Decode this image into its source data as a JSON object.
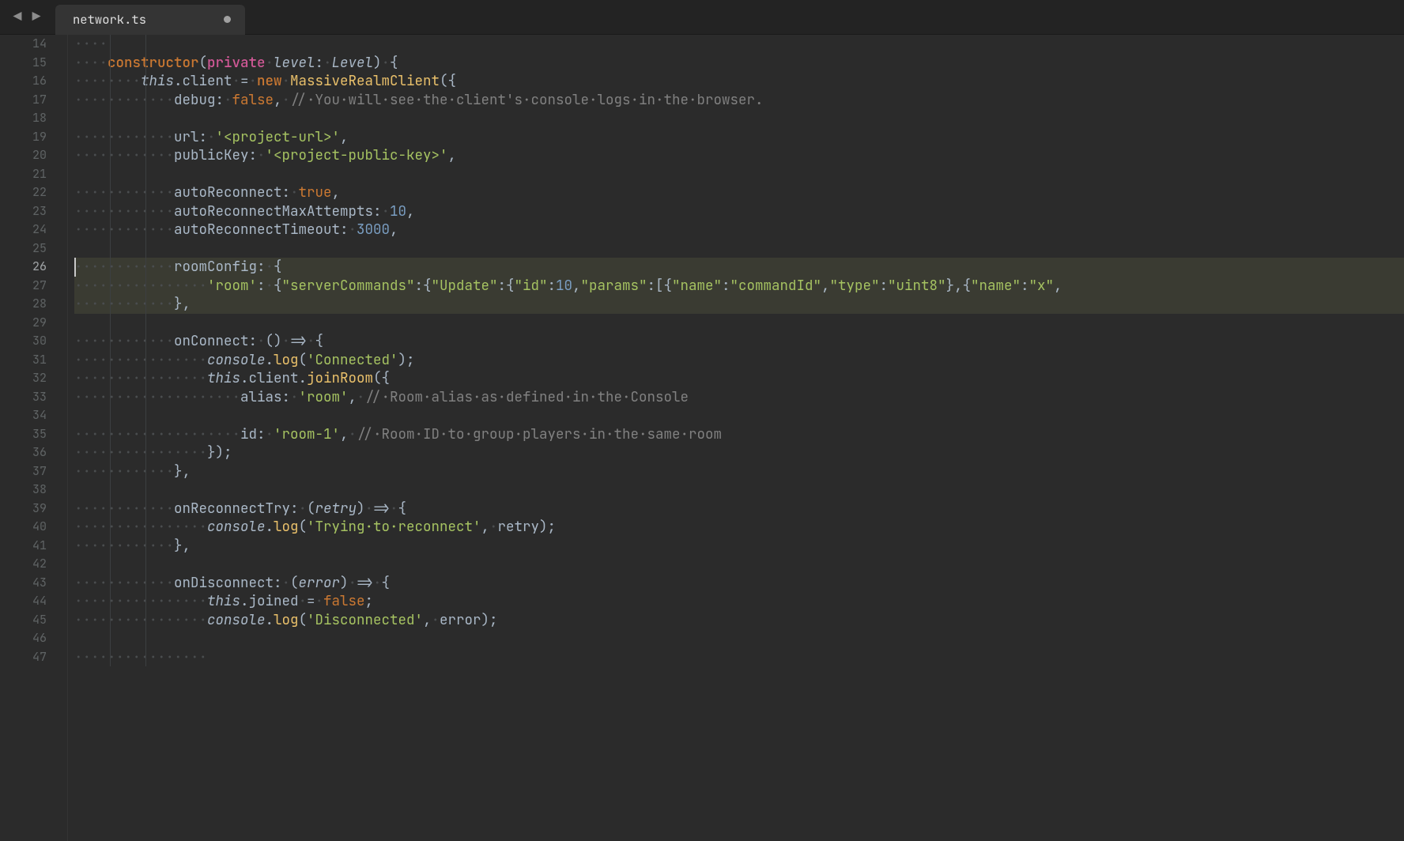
{
  "tab": {
    "filename": "network.ts",
    "modified": true
  },
  "editor": {
    "first_line": 14,
    "cursor_line": 26,
    "selected_lines": [
      26,
      27,
      28
    ],
    "lines": [
      {
        "n": 14,
        "indent": 1,
        "tokens": []
      },
      {
        "n": 15,
        "indent": 1,
        "tokens": [
          [
            "kw",
            "constructor"
          ],
          [
            "op",
            "("
          ],
          [
            "kw2",
            "private"
          ],
          [
            "ws",
            "·"
          ],
          [
            "param",
            "level"
          ],
          [
            "op",
            ":"
          ],
          [
            "ws",
            "·"
          ],
          [
            "type",
            "Level"
          ],
          [
            "op",
            ")"
          ],
          [
            "ws",
            "·"
          ],
          [
            "op",
            "{"
          ]
        ]
      },
      {
        "n": 16,
        "indent": 2,
        "tokens": [
          [
            "this",
            "this"
          ],
          [
            "dot",
            "."
          ],
          [
            "prop",
            "client"
          ],
          [
            "ws",
            "·"
          ],
          [
            "op",
            "="
          ],
          [
            "ws",
            "·"
          ],
          [
            "kw",
            "new"
          ],
          [
            "ws",
            "·"
          ],
          [
            "fn",
            "MassiveRealmClient"
          ],
          [
            "op",
            "({"
          ]
        ]
      },
      {
        "n": 17,
        "indent": 3,
        "tokens": [
          [
            "prop",
            "debug"
          ],
          [
            "op",
            ":"
          ],
          [
            "ws",
            "·"
          ],
          [
            "bool",
            "false"
          ],
          [
            "op",
            ","
          ],
          [
            "ws",
            "·"
          ],
          [
            "comment",
            "//·You·will·see·the·client's·console·logs·in·the·browser."
          ]
        ]
      },
      {
        "n": 18,
        "indent": 0,
        "tokens": []
      },
      {
        "n": 19,
        "indent": 3,
        "tokens": [
          [
            "prop",
            "url"
          ],
          [
            "op",
            ":"
          ],
          [
            "ws",
            "·"
          ],
          [
            "str",
            "'<project-url>'"
          ],
          [
            "op",
            ","
          ]
        ]
      },
      {
        "n": 20,
        "indent": 3,
        "tokens": [
          [
            "prop",
            "publicKey"
          ],
          [
            "op",
            ":"
          ],
          [
            "ws",
            "·"
          ],
          [
            "str",
            "'<project-public-key>'"
          ],
          [
            "op",
            ","
          ]
        ]
      },
      {
        "n": 21,
        "indent": 0,
        "tokens": []
      },
      {
        "n": 22,
        "indent": 3,
        "tokens": [
          [
            "prop",
            "autoReconnect"
          ],
          [
            "op",
            ":"
          ],
          [
            "ws",
            "·"
          ],
          [
            "bool",
            "true"
          ],
          [
            "op",
            ","
          ]
        ]
      },
      {
        "n": 23,
        "indent": 3,
        "tokens": [
          [
            "prop",
            "autoReconnectMaxAttempts"
          ],
          [
            "op",
            ":"
          ],
          [
            "ws",
            "·"
          ],
          [
            "num",
            "10"
          ],
          [
            "op",
            ","
          ]
        ]
      },
      {
        "n": 24,
        "indent": 3,
        "tokens": [
          [
            "prop",
            "autoReconnectTimeout"
          ],
          [
            "op",
            ":"
          ],
          [
            "ws",
            "·"
          ],
          [
            "num",
            "3000"
          ],
          [
            "op",
            ","
          ]
        ]
      },
      {
        "n": 25,
        "indent": 0,
        "tokens": []
      },
      {
        "n": 26,
        "indent": 3,
        "tokens": [
          [
            "prop",
            "roomConfig"
          ],
          [
            "op",
            ":"
          ],
          [
            "ws",
            "·"
          ],
          [
            "op",
            "{"
          ]
        ]
      },
      {
        "n": 27,
        "indent": 4,
        "tokens": [
          [
            "str",
            "'room'"
          ],
          [
            "op",
            ":"
          ],
          [
            "ws",
            "·"
          ],
          [
            "op",
            "{"
          ],
          [
            "key",
            "\"serverCommands\""
          ],
          [
            "op",
            ":{"
          ],
          [
            "key",
            "\"Update\""
          ],
          [
            "op",
            ":{"
          ],
          [
            "key",
            "\"id\""
          ],
          [
            "op",
            ":"
          ],
          [
            "num",
            "10"
          ],
          [
            "op",
            ","
          ],
          [
            "key",
            "\"params\""
          ],
          [
            "op",
            ":[{"
          ],
          [
            "key",
            "\"name\""
          ],
          [
            "op",
            ":"
          ],
          [
            "key",
            "\"commandId\""
          ],
          [
            "op",
            ","
          ],
          [
            "key",
            "\"type\""
          ],
          [
            "op",
            ":"
          ],
          [
            "key",
            "\"uint8\""
          ],
          [
            "op",
            "},{"
          ],
          [
            "key",
            "\"name\""
          ],
          [
            "op",
            ":"
          ],
          [
            "key",
            "\"x\""
          ],
          [
            "op",
            ","
          ]
        ]
      },
      {
        "n": 28,
        "indent": 3,
        "tokens": [
          [
            "op",
            "},"
          ]
        ]
      },
      {
        "n": 29,
        "indent": 0,
        "tokens": []
      },
      {
        "n": 30,
        "indent": 3,
        "tokens": [
          [
            "prop",
            "onConnect"
          ],
          [
            "op",
            ":"
          ],
          [
            "ws",
            "·"
          ],
          [
            "op",
            "()"
          ],
          [
            "ws",
            "·"
          ],
          [
            "op",
            "=>"
          ],
          [
            "ws",
            "·"
          ],
          [
            "op",
            "{"
          ]
        ]
      },
      {
        "n": 31,
        "indent": 4,
        "tokens": [
          [
            "param",
            "console"
          ],
          [
            "dot",
            "."
          ],
          [
            "call",
            "log"
          ],
          [
            "op",
            "("
          ],
          [
            "str",
            "'Connected'"
          ],
          [
            "op",
            ");"
          ]
        ]
      },
      {
        "n": 32,
        "indent": 4,
        "tokens": [
          [
            "this",
            "this"
          ],
          [
            "dot",
            "."
          ],
          [
            "prop",
            "client"
          ],
          [
            "dot",
            "."
          ],
          [
            "call",
            "joinRoom"
          ],
          [
            "op",
            "({"
          ]
        ]
      },
      {
        "n": 33,
        "indent": 5,
        "tokens": [
          [
            "prop",
            "alias"
          ],
          [
            "op",
            ":"
          ],
          [
            "ws",
            "·"
          ],
          [
            "str",
            "'room'"
          ],
          [
            "op",
            ","
          ],
          [
            "ws",
            "·"
          ],
          [
            "comment",
            "//·Room·alias·as·defined·in·the·Console"
          ]
        ]
      },
      {
        "n": 34,
        "indent": 0,
        "tokens": []
      },
      {
        "n": 35,
        "indent": 5,
        "tokens": [
          [
            "prop",
            "id"
          ],
          [
            "op",
            ":"
          ],
          [
            "ws",
            "·"
          ],
          [
            "str",
            "'room-1'"
          ],
          [
            "op",
            ","
          ],
          [
            "ws",
            "·"
          ],
          [
            "comment",
            "//·Room·ID·to·group·players·in·the·same·room"
          ]
        ]
      },
      {
        "n": 36,
        "indent": 4,
        "tokens": [
          [
            "op",
            "});"
          ]
        ]
      },
      {
        "n": 37,
        "indent": 3,
        "tokens": [
          [
            "op",
            "},"
          ]
        ]
      },
      {
        "n": 38,
        "indent": 0,
        "tokens": []
      },
      {
        "n": 39,
        "indent": 3,
        "tokens": [
          [
            "prop",
            "onReconnectTry"
          ],
          [
            "op",
            ":"
          ],
          [
            "ws",
            "·"
          ],
          [
            "op",
            "("
          ],
          [
            "param",
            "retry"
          ],
          [
            "op",
            ")"
          ],
          [
            "ws",
            "·"
          ],
          [
            "op",
            "=>"
          ],
          [
            "ws",
            "·"
          ],
          [
            "op",
            "{"
          ]
        ]
      },
      {
        "n": 40,
        "indent": 4,
        "tokens": [
          [
            "param",
            "console"
          ],
          [
            "dot",
            "."
          ],
          [
            "call",
            "log"
          ],
          [
            "op",
            "("
          ],
          [
            "str",
            "'Trying·to·reconnect'"
          ],
          [
            "op",
            ","
          ],
          [
            "ws",
            "·"
          ],
          [
            "ident",
            "retry"
          ],
          [
            "op",
            ");"
          ]
        ]
      },
      {
        "n": 41,
        "indent": 3,
        "tokens": [
          [
            "op",
            "},"
          ]
        ]
      },
      {
        "n": 42,
        "indent": 0,
        "tokens": []
      },
      {
        "n": 43,
        "indent": 3,
        "tokens": [
          [
            "prop",
            "onDisconnect"
          ],
          [
            "op",
            ":"
          ],
          [
            "ws",
            "·"
          ],
          [
            "op",
            "("
          ],
          [
            "param",
            "error"
          ],
          [
            "op",
            ")"
          ],
          [
            "ws",
            "·"
          ],
          [
            "op",
            "=>"
          ],
          [
            "ws",
            "·"
          ],
          [
            "op",
            "{"
          ]
        ]
      },
      {
        "n": 44,
        "indent": 4,
        "tokens": [
          [
            "this",
            "this"
          ],
          [
            "dot",
            "."
          ],
          [
            "prop",
            "joined"
          ],
          [
            "ws",
            "·"
          ],
          [
            "op",
            "="
          ],
          [
            "ws",
            "·"
          ],
          [
            "bool",
            "false"
          ],
          [
            "op",
            ";"
          ]
        ]
      },
      {
        "n": 45,
        "indent": 4,
        "tokens": [
          [
            "param",
            "console"
          ],
          [
            "dot",
            "."
          ],
          [
            "call",
            "log"
          ],
          [
            "op",
            "("
          ],
          [
            "str",
            "'Disconnected'"
          ],
          [
            "op",
            ","
          ],
          [
            "ws",
            "·"
          ],
          [
            "ident",
            "error"
          ],
          [
            "op",
            ");"
          ]
        ]
      },
      {
        "n": 46,
        "indent": 0,
        "tokens": []
      },
      {
        "n": 47,
        "indent": 4,
        "tokens": []
      }
    ]
  }
}
